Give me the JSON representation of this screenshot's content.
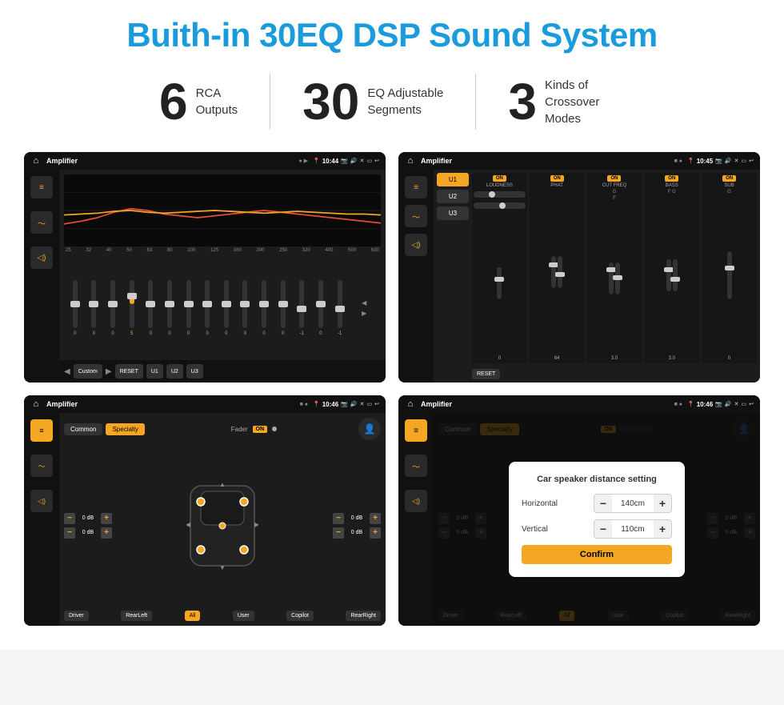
{
  "page": {
    "title": "Buith-in 30EQ DSP Sound System",
    "stats": [
      {
        "number": "6",
        "label_line1": "RCA",
        "label_line2": "Outputs"
      },
      {
        "number": "30",
        "label_line1": "EQ Adjustable",
        "label_line2": "Segments"
      },
      {
        "number": "3",
        "label_line1": "Kinds of",
        "label_line2": "Crossover Modes"
      }
    ]
  },
  "eq_screen": {
    "title": "Amplifier",
    "time": "10:44",
    "freq_labels": [
      "25",
      "32",
      "40",
      "50",
      "63",
      "80",
      "100",
      "125",
      "160",
      "200",
      "250",
      "320",
      "400",
      "500",
      "630"
    ],
    "slider_values": [
      "0",
      "0",
      "0",
      "5",
      "0",
      "0",
      "0",
      "0",
      "0",
      "0",
      "0",
      "0",
      "-1",
      "0",
      "-1"
    ],
    "preset": "Custom",
    "buttons": [
      "RESET",
      "U1",
      "U2",
      "U3"
    ]
  },
  "crossover_screen": {
    "title": "Amplifier",
    "time": "10:45",
    "u_buttons": [
      "U1",
      "U2",
      "U3"
    ],
    "active_u": "U1",
    "columns": [
      {
        "label": "LOUDNESS",
        "on": true
      },
      {
        "label": "PHAT",
        "on": true
      },
      {
        "label": "CUT FREQ",
        "on": true
      },
      {
        "label": "BASS",
        "on": true
      },
      {
        "label": "SUB",
        "on": true
      }
    ],
    "reset_label": "RESET"
  },
  "speaker_screen": {
    "title": "Amplifier",
    "time": "10:46",
    "tabs": [
      "Common",
      "Specialty"
    ],
    "active_tab": "Specialty",
    "fader_label": "Fader",
    "fader_on": "ON",
    "left_controls": [
      {
        "label": "0 dB"
      },
      {
        "label": "0 dB"
      }
    ],
    "right_controls": [
      {
        "label": "0 dB"
      },
      {
        "label": "0 dB"
      }
    ],
    "bottom_buttons": [
      "Driver",
      "RearLeft",
      "All",
      "User",
      "Copilot",
      "RearRight"
    ]
  },
  "distance_screen": {
    "title": "Amplifier",
    "time": "10:46",
    "tabs": [
      "Common",
      "Specialty"
    ],
    "dialog": {
      "title": "Car speaker distance setting",
      "horizontal_label": "Horizontal",
      "horizontal_value": "140cm",
      "vertical_label": "Vertical",
      "vertical_value": "110cm",
      "confirm_label": "Confirm"
    },
    "left_controls": [
      {
        "label": "0 dB"
      },
      {
        "label": "0 dB"
      }
    ],
    "right_controls": [
      {
        "label": "0 dB"
      },
      {
        "label": "0 dB"
      }
    ],
    "bottom_buttons": [
      "Driver",
      "RearLeft",
      "All",
      "User",
      "Copilot",
      "RearRight"
    ]
  }
}
